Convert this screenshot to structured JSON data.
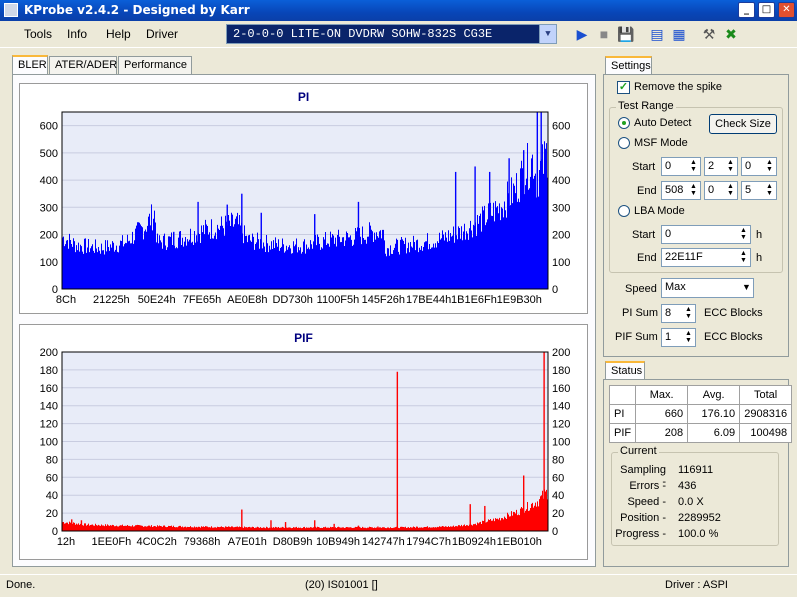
{
  "app": {
    "title": "KProbe v2.4.2 - Designed by Karr"
  },
  "menu": [
    "Tools",
    "Info",
    "Help",
    "Driver"
  ],
  "drive": "2-0-0-0 LITE-ON DVDRW SOHW-832S  CG3E",
  "tabs": [
    "BLER",
    "ATER/ADER",
    "Performance"
  ],
  "pi_chart": {
    "title": "PI",
    "ticks_y": [
      "600",
      "500",
      "400",
      "300",
      "200",
      "100",
      "0"
    ],
    "ticks_x": [
      "8Ch",
      "21225h",
      "50E24h",
      "7FE65h",
      "AE0E8h",
      "DD730h",
      "1100F5h",
      "145F26h",
      "17BE44h",
      "1B1E6Fh",
      "1E9B30h"
    ]
  },
  "pif_chart": {
    "title": "PIF",
    "ticks_y": [
      "200",
      "180",
      "160",
      "140",
      "120",
      "100",
      "80",
      "60",
      "40",
      "20",
      "0"
    ],
    "ticks_x": [
      "12h",
      "1EE0Fh",
      "4C0C2h",
      "79368h",
      "A7E01h",
      "D80B9h",
      "10B949h",
      "142747h",
      "1794C7h",
      "1B0924h",
      "1EB010h"
    ]
  },
  "settings": {
    "tab": "Settings",
    "remove_spike": "Remove the spike",
    "test_range": "Test Range",
    "auto_detect": "Auto Detect",
    "check_size": "Check Size",
    "msf_mode": "MSF Mode",
    "start": "Start",
    "end": "End",
    "msf_start": [
      "0",
      "2",
      "0"
    ],
    "msf_end": [
      "508",
      "0",
      "5"
    ],
    "lba_mode": "LBA Mode",
    "lba_start": "0",
    "lba_end": "22E11F",
    "h": "h",
    "speed_label": "Speed",
    "speed": "Max",
    "pi_sum_label": "PI Sum",
    "pi_sum": "8",
    "pif_sum_label": "PIF Sum",
    "pif_sum": "1",
    "ecc": "ECC Blocks"
  },
  "status": {
    "tab": "Status",
    "headers": [
      "",
      "Max.",
      "Avg.",
      "Total"
    ],
    "rows": [
      [
        "PI",
        "660",
        "176.10",
        "2908316"
      ],
      [
        "PIF",
        "208",
        "6.09",
        "100498"
      ]
    ],
    "current": "Current",
    "sampling_label": "Sampling -",
    "sampling": "116911",
    "errors_label": "Errors -",
    "errors": "436",
    "speed_label": "Speed -",
    "speed": "0.0  X",
    "position_label": "Position -",
    "position": "2289952",
    "progress_label": "Progress -",
    "progress": "100.0 %"
  },
  "statusbar": {
    "left": "Done.",
    "mid": "(20) IS01001 []",
    "right": "Driver : ASPI"
  },
  "chart_data": [
    {
      "type": "area",
      "title": "PI",
      "ylim": [
        0,
        650
      ],
      "color": "#0000ff",
      "profile": [
        [
          0,
          190
        ],
        [
          3,
          160
        ],
        [
          8,
          150
        ],
        [
          13,
          170
        ],
        [
          17,
          230
        ],
        [
          19,
          280
        ],
        [
          19.5,
          170
        ],
        [
          25,
          190
        ],
        [
          30,
          220
        ],
        [
          36,
          240
        ],
        [
          38,
          180
        ],
        [
          41,
          170
        ],
        [
          45,
          160
        ],
        [
          50,
          160
        ],
        [
          55,
          180
        ],
        [
          60,
          190
        ],
        [
          64,
          210
        ],
        [
          66,
          210
        ],
        [
          66.5,
          150
        ],
        [
          70,
          160
        ],
        [
          74,
          170
        ],
        [
          78,
          185
        ],
        [
          82,
          210
        ],
        [
          86,
          250
        ],
        [
          90,
          300
        ],
        [
          93,
          360
        ],
        [
          95,
          430
        ],
        [
          97,
          480
        ],
        [
          97.5,
          400
        ],
        [
          99,
          460
        ],
        [
          100,
          520
        ]
      ],
      "spikes": [
        [
          23,
          210
        ],
        [
          28,
          320
        ],
        [
          34,
          310
        ],
        [
          37,
          350
        ],
        [
          41,
          280
        ],
        [
          52,
          275
        ],
        [
          61,
          320
        ],
        [
          81,
          430
        ],
        [
          85,
          450
        ],
        [
          88,
          430
        ],
        [
          92,
          480
        ],
        [
          95,
          510
        ],
        [
          97.8,
          660
        ],
        [
          98.6,
          660
        ]
      ]
    },
    {
      "type": "area",
      "title": "PIF",
      "ylim": [
        0,
        200
      ],
      "color": "#ff0000",
      "profile": [
        [
          0,
          10
        ],
        [
          5,
          7
        ],
        [
          12,
          6
        ],
        [
          25,
          5
        ],
        [
          40,
          4
        ],
        [
          55,
          4
        ],
        [
          70,
          4
        ],
        [
          80,
          5
        ],
        [
          85,
          8
        ],
        [
          90,
          14
        ],
        [
          94,
          22
        ],
        [
          98,
          34
        ],
        [
          99.5,
          42
        ],
        [
          100,
          45
        ]
      ],
      "spikes": [
        [
          2,
          13
        ],
        [
          4,
          12
        ],
        [
          37,
          24
        ],
        [
          43,
          12
        ],
        [
          46,
          10
        ],
        [
          52,
          12
        ],
        [
          56,
          8
        ],
        [
          61,
          6
        ],
        [
          65,
          5
        ],
        [
          69,
          178
        ],
        [
          73,
          5
        ],
        [
          84,
          30
        ],
        [
          87,
          28
        ],
        [
          95,
          62
        ],
        [
          99.2,
          208
        ]
      ]
    }
  ]
}
